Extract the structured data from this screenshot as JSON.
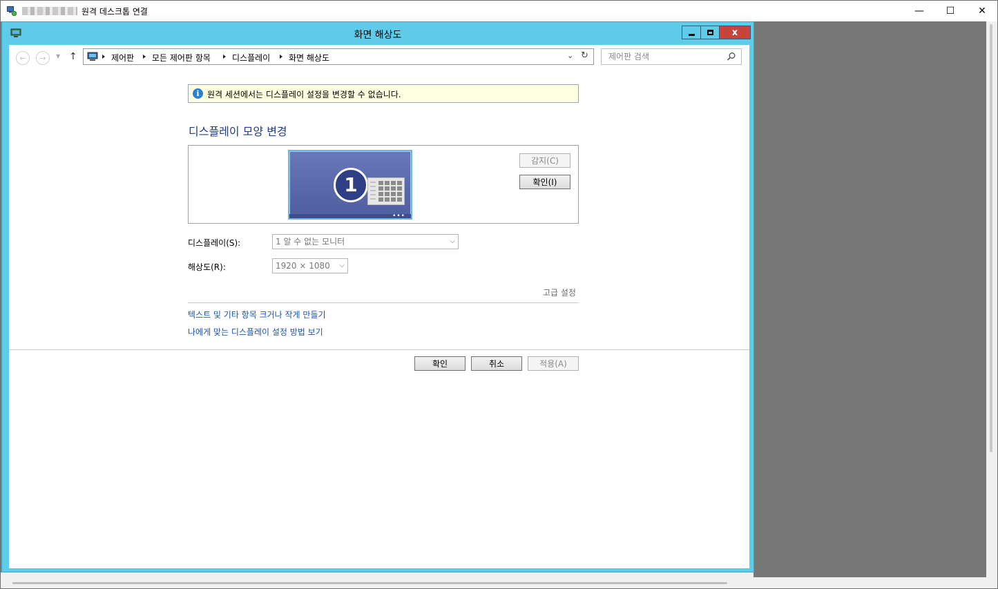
{
  "rdp_window": {
    "title": "원격 데스크톱 연결",
    "minimize_glyph": "—",
    "maximize_glyph": "☐",
    "close_glyph": "✕"
  },
  "dialog": {
    "title": "화면 해상도",
    "close_glyph": "x"
  },
  "address_bar": {
    "breadcrumbs": [
      "제어판",
      "모든 제어판 항목",
      "디스플레이",
      "화면 해상도"
    ],
    "dropdown_glyph": "⌄",
    "refresh_glyph": "↻"
  },
  "search": {
    "placeholder": "제어판 검색"
  },
  "info_bar": {
    "icon_glyph": "i",
    "text": "원격 세션에서는 디스플레이 설정을 변경할 수 없습니다."
  },
  "heading": "디스플레이 모양 변경",
  "preview": {
    "monitor_number": "1",
    "monitor_dots": "•••",
    "detect_button": "감지(C)",
    "identify_button": "확인(I)"
  },
  "display_field": {
    "label": "디스플레이(S):",
    "value": "1  알 수 없는 모니터"
  },
  "resolution_field": {
    "label": "해상도(R):",
    "value": "1920 × 1080"
  },
  "advanced_link": "고급 설정",
  "links": [
    "텍스트 및 기타 항목 크거나 작게 만들기",
    "나에게 맞는 디스플레이 설정 방법 보기"
  ],
  "footer": {
    "ok": "확인",
    "cancel": "취소",
    "apply": "적용(A)"
  }
}
